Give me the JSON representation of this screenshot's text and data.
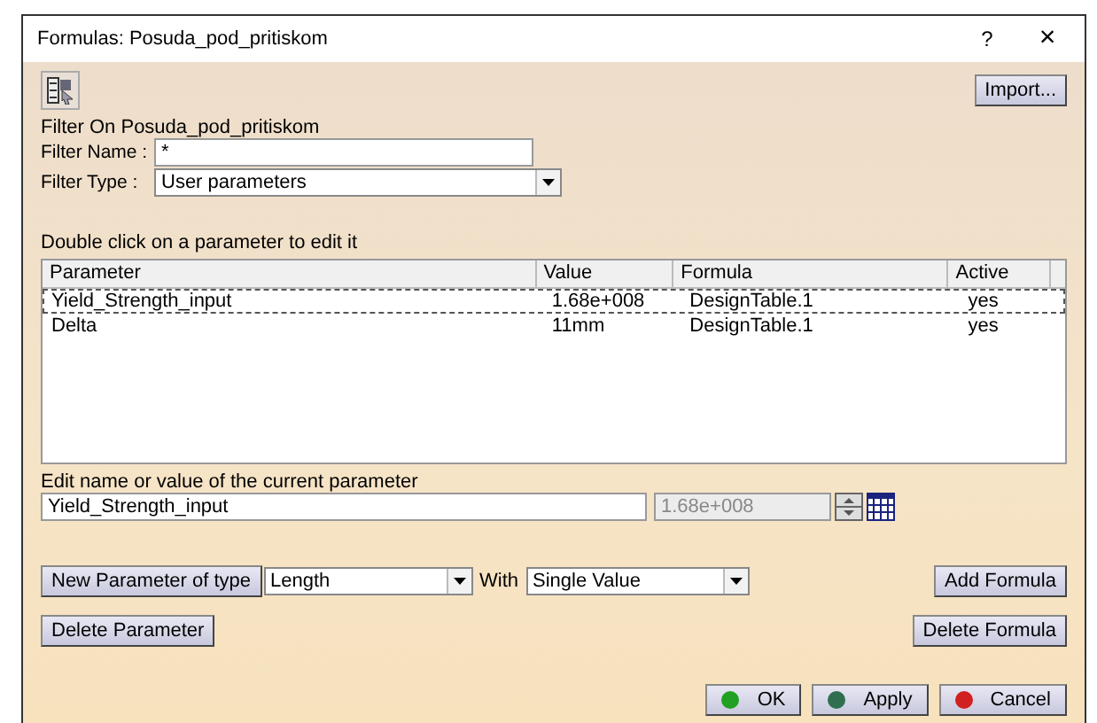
{
  "window": {
    "title": "Formulas: Posuda_pod_pritiskom",
    "help": "?",
    "close": "×"
  },
  "import_button": "Import...",
  "filter": {
    "on_label": "Filter On Posuda_pod_pritiskom",
    "name_label": "Filter Name :",
    "name_value": "*",
    "type_label": "Filter Type :",
    "type_value": "User parameters"
  },
  "table": {
    "caption": "Double click on a parameter to edit it",
    "columns": [
      "Parameter",
      "Value",
      "Formula",
      "Active"
    ],
    "rows": [
      {
        "cells": [
          "Yield_Strength_input",
          "1.68e+008",
          "DesignTable.1",
          "yes"
        ],
        "selected": true
      },
      {
        "cells": [
          "Delta",
          "11mm",
          "DesignTable.1",
          "yes"
        ],
        "selected": false
      }
    ]
  },
  "edit": {
    "label": "Edit name or value of the current parameter",
    "name_value": "Yield_Strength_input",
    "value": "1.68e+008",
    "value_disabled": true
  },
  "new_parameter": {
    "button": "New Parameter of type",
    "type_value": "Length",
    "with_label": "With",
    "with_value": "Single Value"
  },
  "add_formula": "Add Formula",
  "delete_parameter": "Delete Parameter",
  "delete_formula": "Delete Formula",
  "buttons": [
    {
      "label": "OK",
      "color": "#22a022"
    },
    {
      "label": "Apply",
      "color": "#2f6f4f"
    },
    {
      "label": "Cancel",
      "color": "#d02020"
    }
  ]
}
